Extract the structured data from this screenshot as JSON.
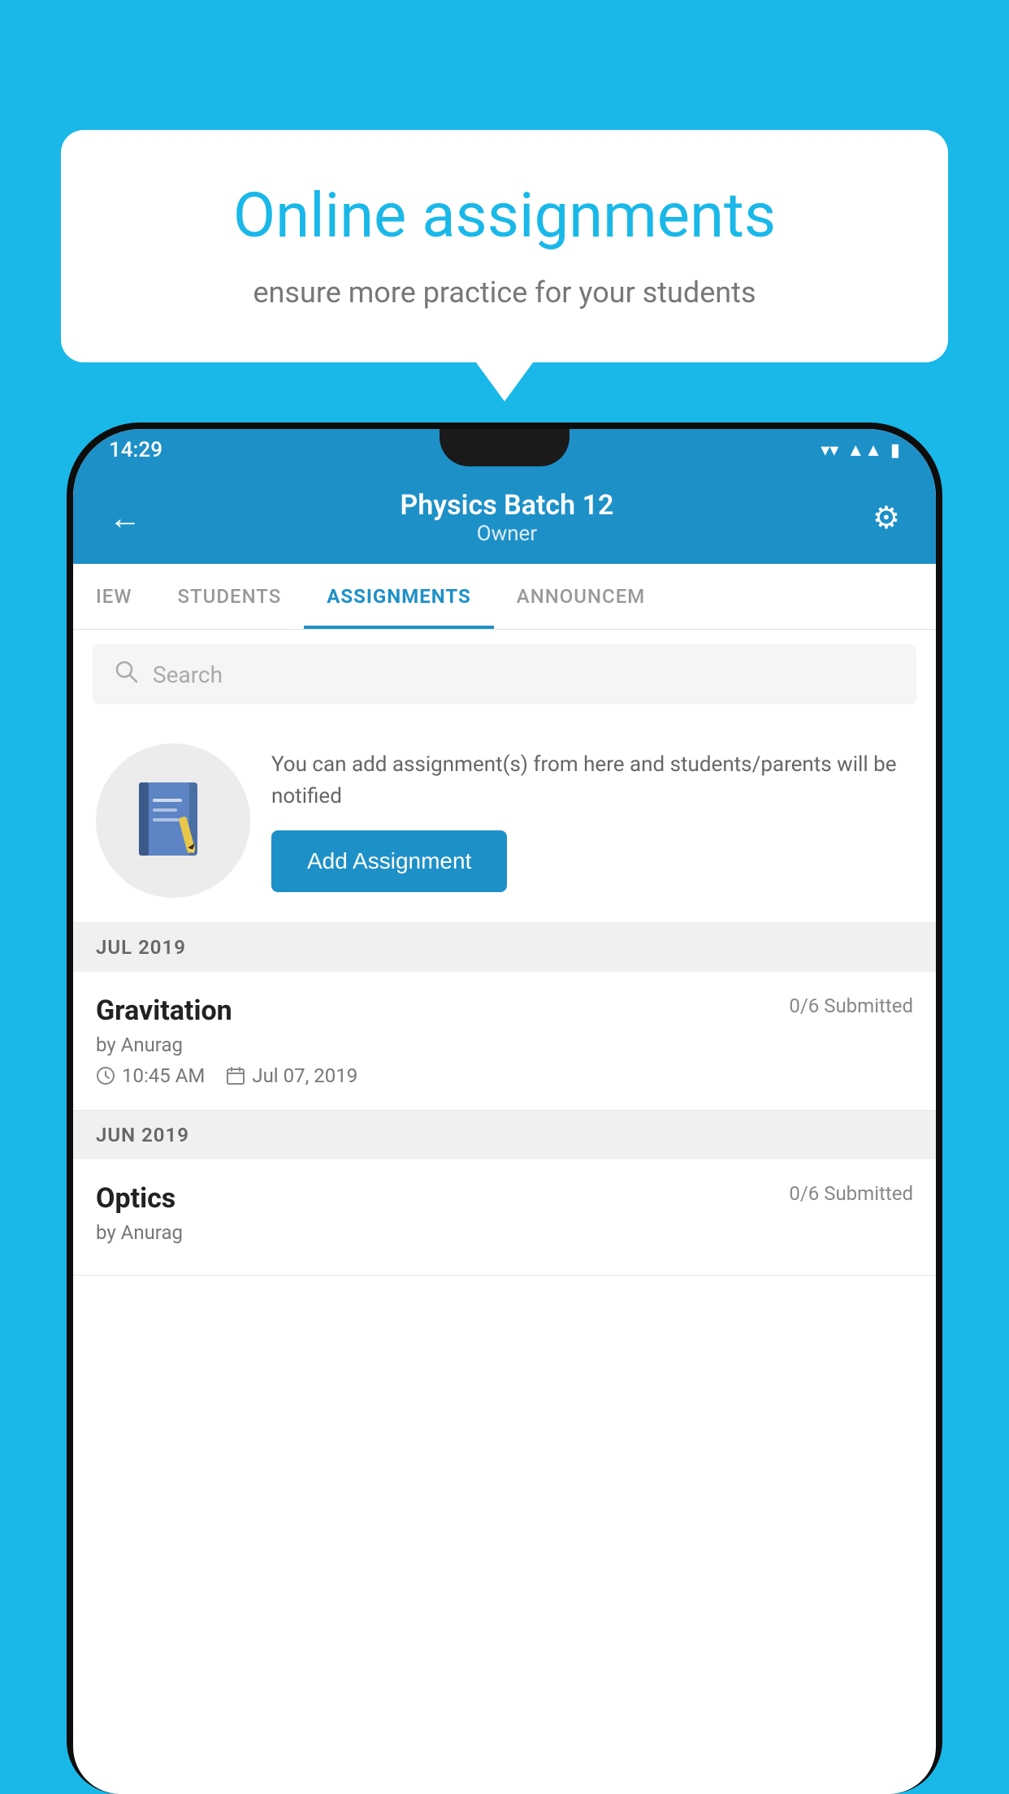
{
  "background_color": "#1ab8e8",
  "speech_bubble": {
    "title": "Online assignments",
    "subtitle": "ensure more practice for your students"
  },
  "phone": {
    "status_bar": {
      "time": "14:29",
      "icons": [
        "wifi",
        "signal",
        "battery"
      ]
    },
    "header": {
      "title": "Physics Batch 12",
      "subtitle": "Owner",
      "back_label": "←",
      "settings_label": "⚙"
    },
    "tabs": [
      {
        "label": "IEW",
        "active": false
      },
      {
        "label": "STUDENTS",
        "active": false
      },
      {
        "label": "ASSIGNMENTS",
        "active": true
      },
      {
        "label": "ANNOUNCEM",
        "active": false
      }
    ],
    "search": {
      "placeholder": "Search"
    },
    "prompt": {
      "text": "You can add assignment(s) from here and students/parents will be notified",
      "button_label": "Add Assignment"
    },
    "sections": [
      {
        "header": "JUL 2019",
        "assignments": [
          {
            "name": "Gravitation",
            "submitted": "0/6 Submitted",
            "author": "by Anurag",
            "time": "10:45 AM",
            "date": "Jul 07, 2019"
          }
        ]
      },
      {
        "header": "JUN 2019",
        "assignments": [
          {
            "name": "Optics",
            "submitted": "0/6 Submitted",
            "author": "by Anurag",
            "time": "",
            "date": ""
          }
        ]
      }
    ]
  }
}
